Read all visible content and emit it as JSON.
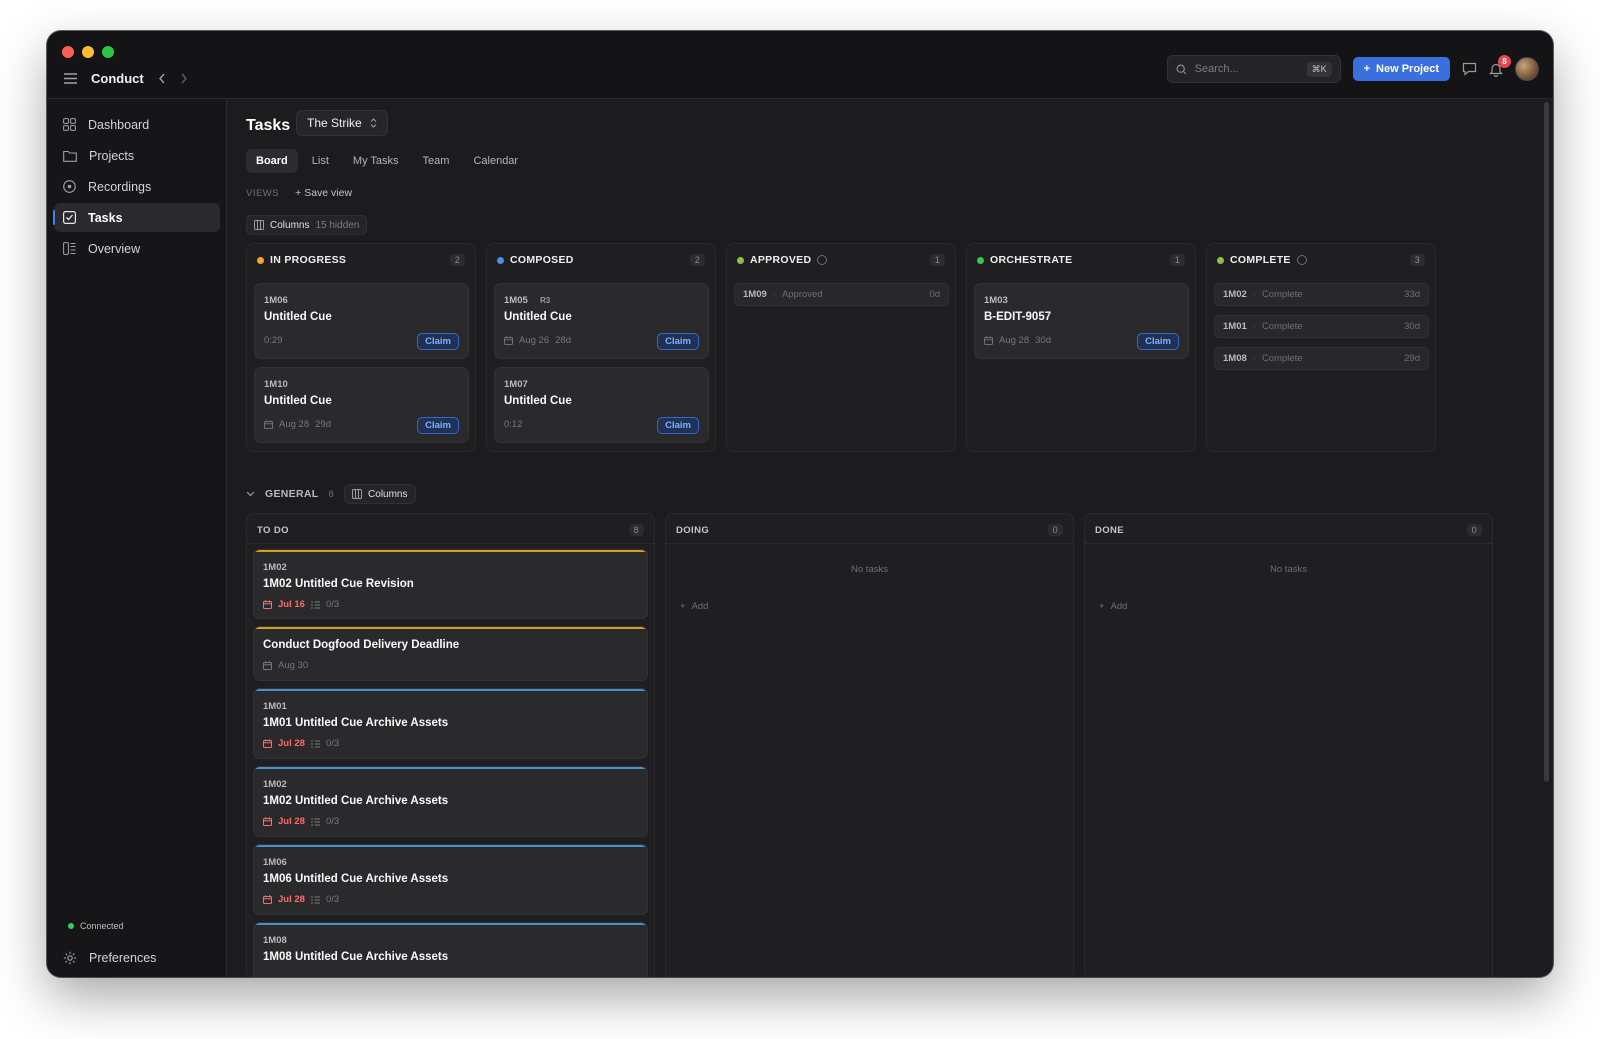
{
  "app": {
    "brand": "Conduct",
    "search_placeholder": "Search...",
    "search_shortcut": "⌘K",
    "new_project_label": "New Project",
    "notification_count": "8"
  },
  "sidebar": {
    "items": [
      {
        "label": "Dashboard",
        "icon": "grid-icon"
      },
      {
        "label": "Projects",
        "icon": "folder-icon"
      },
      {
        "label": "Recordings",
        "icon": "record-icon"
      },
      {
        "label": "Tasks",
        "icon": "checkbox-icon",
        "active": true
      },
      {
        "label": "Overview",
        "icon": "overview-icon"
      }
    ],
    "status": "Connected",
    "preferences_label": "Preferences"
  },
  "main": {
    "title": "Tasks",
    "project_selected": "The Strike",
    "tabs": [
      "Board",
      "List",
      "My Tasks",
      "Team",
      "Calendar"
    ],
    "active_tab": "Board",
    "views_label": "VIEWS",
    "save_view_label": "Save view",
    "columns_label": "Columns",
    "columns_hidden": "15 hidden"
  },
  "board": {
    "columns": [
      {
        "name": "IN PROGRESS",
        "count": "2",
        "color": "#f5a623",
        "cards": [
          {
            "id": "1M06",
            "title": "Untitled Cue",
            "meta": "0:29",
            "action": "Claim"
          },
          {
            "id": "1M10",
            "title": "Untitled Cue",
            "date": "Aug 28",
            "age": "29d",
            "action": "Claim"
          }
        ]
      },
      {
        "name": "COMPOSED",
        "count": "2",
        "color": "#4a90e2",
        "cards": [
          {
            "id": "1M05",
            "tag": "R3",
            "title": "Untitled Cue",
            "date": "Aug 26",
            "age": "28d",
            "action": "Claim"
          },
          {
            "id": "1M07",
            "title": "Untitled Cue",
            "meta": "0:12",
            "action": "Claim"
          }
        ]
      },
      {
        "name": "APPROVED",
        "count": "1",
        "color": "#8bc34a",
        "mini": [
          {
            "id": "1M09",
            "status": "Approved",
            "age": "0d"
          }
        ]
      },
      {
        "name": "ORCHESTRATE",
        "count": "1",
        "color": "#34c759",
        "cards": [
          {
            "id": "1M03",
            "title": "B-EDIT-9057",
            "date": "Aug 28",
            "age": "30d",
            "action": "Claim"
          }
        ]
      },
      {
        "name": "COMPLETE",
        "count": "3",
        "color": "#8bc34a",
        "mini": [
          {
            "id": "1M02",
            "status": "Complete",
            "age": "33d"
          },
          {
            "id": "1M01",
            "status": "Complete",
            "age": "30d"
          },
          {
            "id": "1M08",
            "status": "Complete",
            "age": "29d"
          }
        ]
      }
    ]
  },
  "general": {
    "label": "GENERAL",
    "count": "8",
    "columns_label": "Columns",
    "lanes": [
      {
        "name": "TO DO",
        "count": "8"
      },
      {
        "name": "DOING",
        "count": "0",
        "empty": "No tasks",
        "add": "Add"
      },
      {
        "name": "DONE",
        "count": "0",
        "empty": "No tasks",
        "add": "Add"
      }
    ],
    "todo": [
      {
        "id": "1M02",
        "title": "1M02 Untitled Cue Revision",
        "due": "Jul 16",
        "subtasks": "0/3",
        "bar": "#d4a017"
      },
      {
        "title": "Conduct Dogfood Delivery Deadline",
        "due": "Aug 30",
        "bar": "#d4a017"
      },
      {
        "id": "1M01",
        "title": "1M01 Untitled Cue Archive Assets",
        "due": "Jul 28",
        "subtasks": "0/3",
        "bar": "#4a90c8"
      },
      {
        "id": "1M02",
        "title": "1M02 Untitled Cue Archive Assets",
        "due": "Jul 28",
        "subtasks": "0/3",
        "bar": "#4a90c8"
      },
      {
        "id": "1M06",
        "title": "1M06 Untitled Cue Archive Assets",
        "due": "Jul 28",
        "subtasks": "0/3",
        "bar": "#4a90c8"
      },
      {
        "id": "1M08",
        "title": "1M08 Untitled Cue Archive Assets",
        "bar": "#4a90c8"
      }
    ]
  }
}
